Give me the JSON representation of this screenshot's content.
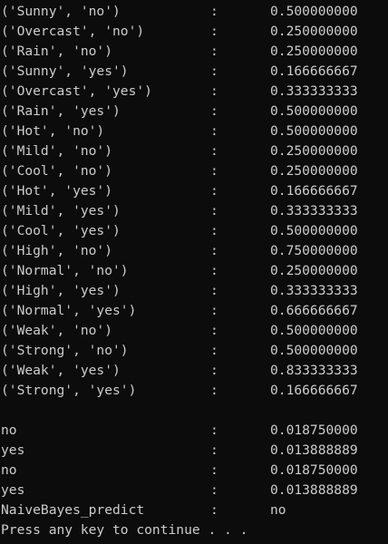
{
  "console": {
    "probabilities": [
      {
        "key": "('Sunny', 'no')",
        "sep": ":",
        "value": "0.500000000"
      },
      {
        "key": "('Overcast', 'no')",
        "sep": ":",
        "value": "0.250000000"
      },
      {
        "key": "('Rain', 'no')",
        "sep": ":",
        "value": "0.250000000"
      },
      {
        "key": "('Sunny', 'yes')",
        "sep": ":",
        "value": "0.166666667"
      },
      {
        "key": "('Overcast', 'yes')",
        "sep": ":",
        "value": "0.333333333"
      },
      {
        "key": "('Rain', 'yes')",
        "sep": ":",
        "value": "0.500000000"
      },
      {
        "key": "('Hot', 'no')",
        "sep": ":",
        "value": "0.500000000"
      },
      {
        "key": "('Mild', 'no')",
        "sep": ":",
        "value": "0.250000000"
      },
      {
        "key": "('Cool', 'no')",
        "sep": ":",
        "value": "0.250000000"
      },
      {
        "key": "('Hot', 'yes')",
        "sep": ":",
        "value": "0.166666667"
      },
      {
        "key": "('Mild', 'yes')",
        "sep": ":",
        "value": "0.333333333"
      },
      {
        "key": "('Cool', 'yes')",
        "sep": ":",
        "value": "0.500000000"
      },
      {
        "key": "('High', 'no')",
        "sep": ":",
        "value": "0.750000000"
      },
      {
        "key": "('Normal', 'no')",
        "sep": ":",
        "value": "0.250000000"
      },
      {
        "key": "('High', 'yes')",
        "sep": ":",
        "value": "0.333333333"
      },
      {
        "key": "('Normal', 'yes')",
        "sep": ":",
        "value": "0.666666667"
      },
      {
        "key": "('Weak', 'no')",
        "sep": ":",
        "value": "0.500000000"
      },
      {
        "key": "('Strong', 'no')",
        "sep": ":",
        "value": "0.500000000"
      },
      {
        "key": "('Weak', 'yes')",
        "sep": ":",
        "value": "0.833333333"
      },
      {
        "key": "('Strong', 'yes')",
        "sep": ":",
        "value": "0.166666667"
      }
    ],
    "results": [
      {
        "key": "no",
        "sep": ":",
        "value": "0.018750000"
      },
      {
        "key": "yes",
        "sep": ":",
        "value": "0.013888889"
      },
      {
        "key": "no",
        "sep": ":",
        "value": "0.018750000"
      },
      {
        "key": "yes",
        "sep": ":",
        "value": "0.013888889"
      },
      {
        "key": "NaiveBayes_predict",
        "sep": ":",
        "value": "no"
      }
    ],
    "footer": "Press any key to continue . . ."
  },
  "colors": {
    "background": "#0c0c0c",
    "foreground": "#cccccc"
  }
}
